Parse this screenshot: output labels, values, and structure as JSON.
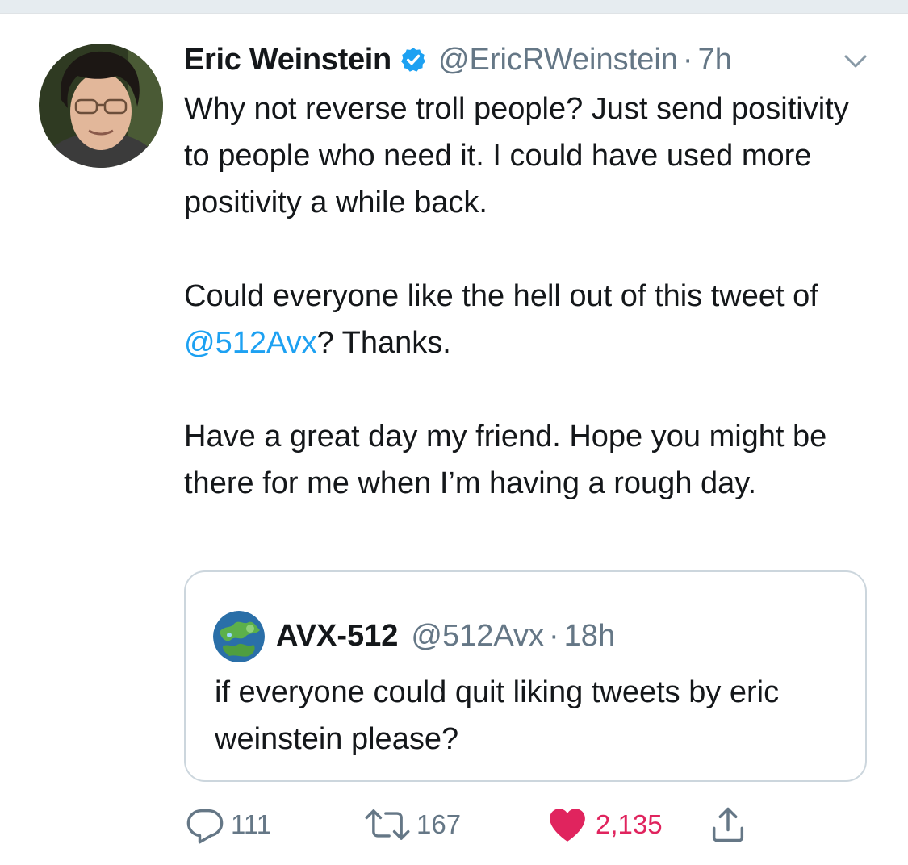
{
  "tweet": {
    "author_name": "Eric Weinstein",
    "author_handle": "@EricRWeinstein",
    "separator": "·",
    "time": "7h",
    "verified": true,
    "text": {
      "p1": "Why not reverse troll people? Just send positivity to people who need it. I could have used more positivity a while back.",
      "p2_before": "Could everyone like the hell out of this tweet of ",
      "p2_mention": "@512Avx",
      "p2_after": "? Thanks.",
      "p3": "Have a great day my friend. Hope you might be there for me when I’m having a rough day."
    }
  },
  "quoted_tweet": {
    "author_name": "AVX-512",
    "author_handle": "@512Avx",
    "separator": "·",
    "time": "18h",
    "text": "if everyone could quit liking tweets by eric weinstein please?"
  },
  "actions": {
    "reply_count": "111",
    "retweet_count": "167",
    "like_count": "2,135",
    "liked": true
  },
  "icons": {
    "verified": "verified-badge-icon",
    "caret": "chevron-down-icon",
    "reply": "reply-icon",
    "retweet": "retweet-icon",
    "like": "heart-icon",
    "share": "share-icon"
  },
  "colors": {
    "link": "#1da1f2",
    "secondary_text": "#657786",
    "like": "#e0245e",
    "border": "#ccd6dd"
  }
}
